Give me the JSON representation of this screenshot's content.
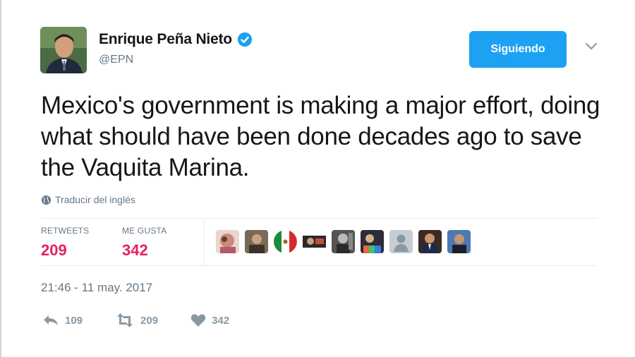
{
  "user": {
    "name": "Enrique Peña Nieto",
    "handle": "@EPN",
    "verified": true
  },
  "follow_button": {
    "label": "Siguiendo"
  },
  "tweet": {
    "text": "Mexico's government is making a major effort, doing what should have been done decades ago to save the Vaquita Marina.",
    "translate_label": "Traducir del inglés",
    "timestamp": "21:46 - 11 may. 2017"
  },
  "stats": {
    "retweets_label": "RETWEETS",
    "retweets_value": "209",
    "likes_label": "ME GUSTA",
    "likes_value": "342"
  },
  "actions": {
    "reply_count": "109",
    "retweet_count": "209",
    "like_count": "342"
  },
  "colors": {
    "accent": "#1da1f2",
    "like_count": "#e0245e",
    "muted": "#657786"
  },
  "likers": [
    "liker-avatar-1",
    "liker-avatar-2",
    "liker-avatar-mexico-flag",
    "liker-avatar-4",
    "liker-avatar-5",
    "liker-avatar-6",
    "liker-avatar-default",
    "liker-avatar-8",
    "liker-avatar-9"
  ]
}
